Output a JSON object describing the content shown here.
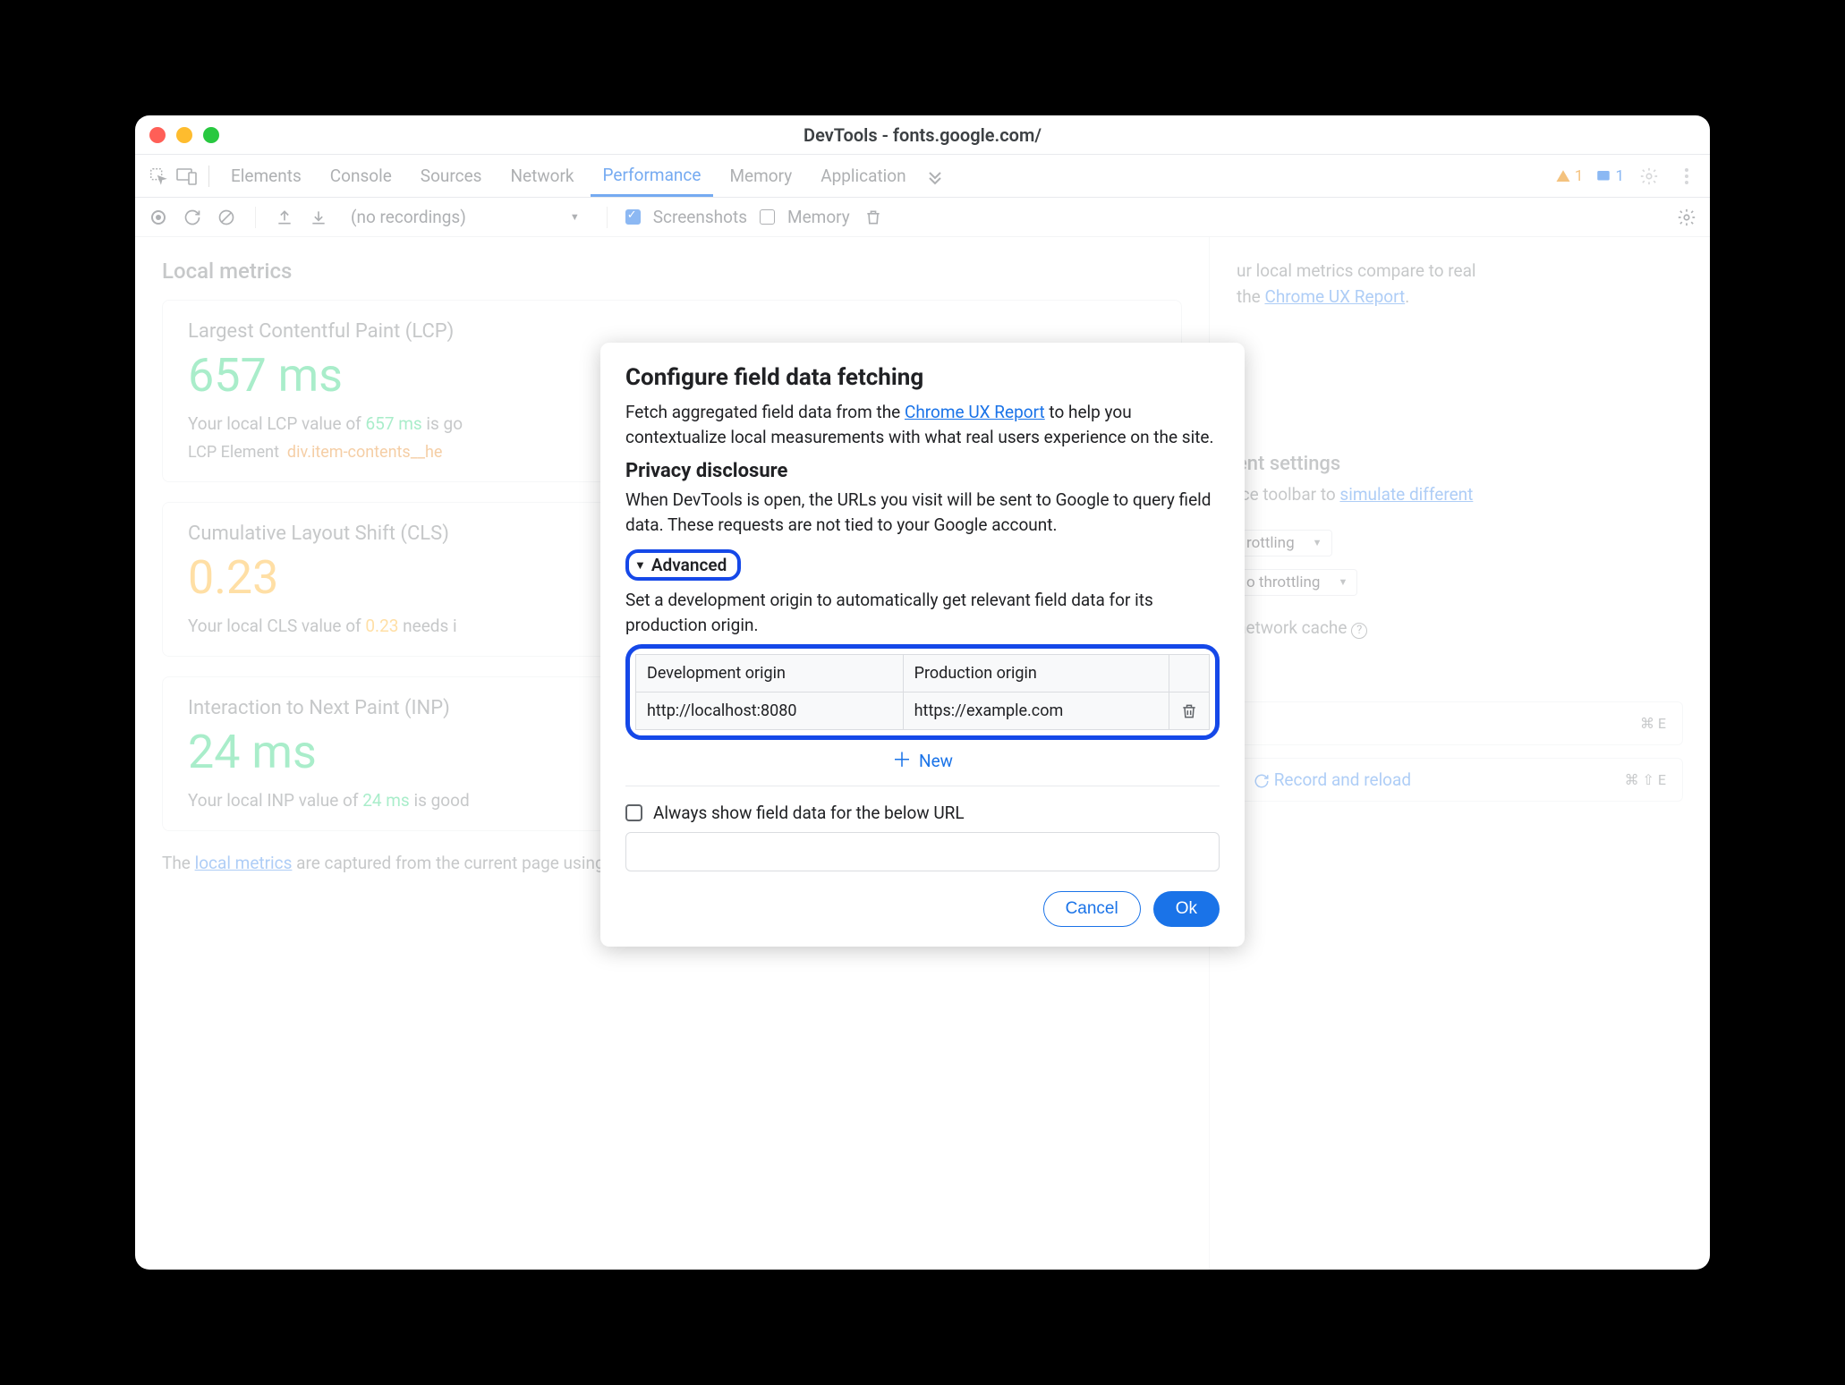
{
  "window": {
    "title": "DevTools - fonts.google.com/"
  },
  "tabs": {
    "items": [
      "Elements",
      "Console",
      "Sources",
      "Network",
      "Performance",
      "Memory",
      "Application"
    ],
    "active": "Performance",
    "warn_count": "1",
    "info_count": "1"
  },
  "toolbar": {
    "recordings": "(no recordings)",
    "screenshots": "Screenshots",
    "memory": "Memory"
  },
  "local_metrics": {
    "title": "Local metrics",
    "lcp": {
      "label": "Largest Contentful Paint (LCP)",
      "value": "657 ms",
      "desc_prefix": "Your local LCP value of ",
      "desc_hl": "657 ms",
      "desc_suffix": " is go",
      "element_label": "LCP Element",
      "element_sel": "div.item-contents__he"
    },
    "cls": {
      "label": "Cumulative Layout Shift (CLS)",
      "value": "0.23",
      "desc_prefix": "Your local CLS value of ",
      "desc_hl": "0.23",
      "desc_suffix": " needs i"
    },
    "inp": {
      "label": "Interaction to Next Paint (INP)",
      "value": "24 ms",
      "desc_prefix": "Your local INP value of ",
      "desc_hl": "24 ms",
      "desc_suffix": " is good"
    },
    "footer_prefix": "The ",
    "footer_link": "local metrics",
    "footer_suffix": " are captured from the current page using your network connection and device."
  },
  "right": {
    "compare_text_prefix": "ur local metrics compare to real",
    "compare_text_mid": " the ",
    "compare_link": "Chrome UX Report",
    "settings_title": "ent settings",
    "simulate_prefix": "ice toolbar to ",
    "simulate_link": "simulate different",
    "throttling1": "rottling",
    "throttling2": "o throttling",
    "cache": "network cache",
    "record_reload": "Record and reload",
    "kbd1": "⌘ E",
    "kbd2": "⌘ ⇧ E"
  },
  "modal": {
    "h2": "Configure field data fetching",
    "p1_prefix": "Fetch aggregated field data from the ",
    "p1_link": "Chrome UX Report",
    "p1_suffix": " to help you contextualize local measurements with what real users experience on the site.",
    "h3": "Privacy disclosure",
    "p2": "When DevTools is open, the URLs you visit will be sent to Google to query field data. These requests are not tied to your Google account.",
    "advanced": "Advanced",
    "adv_desc": "Set a development origin to automatically get relevant field data for its production origin.",
    "th1": "Development origin",
    "th2": "Production origin",
    "td1": "http://localhost:8080",
    "td2": "https://example.com",
    "new": "New",
    "always": "Always show field data for the below URL",
    "cancel": "Cancel",
    "ok": "Ok"
  }
}
